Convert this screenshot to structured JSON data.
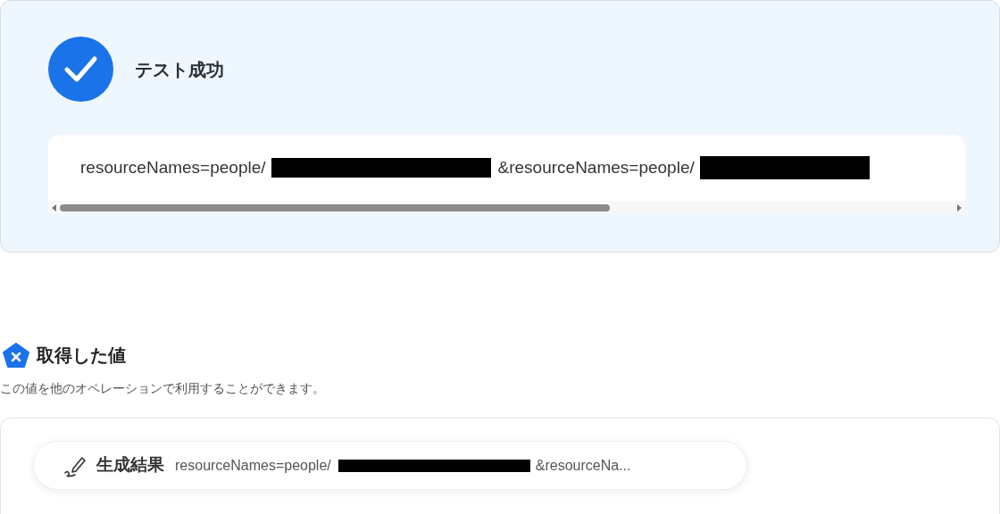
{
  "test_result": {
    "success": true,
    "title": "テスト成功",
    "value_parts": [
      "resourceNames=people/",
      "&resourceNames=people/"
    ]
  },
  "output_section": {
    "title": "取得した値",
    "description": "この値を他のオペレーションで利用することができます。",
    "result_chip": {
      "label": "生成結果",
      "value_parts": [
        "resourceNames=people/",
        "&resourceNa..."
      ]
    }
  }
}
